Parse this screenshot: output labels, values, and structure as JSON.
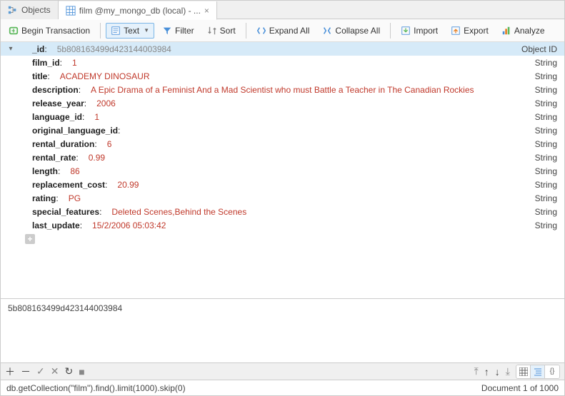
{
  "tabs": [
    {
      "label": "Objects"
    },
    {
      "label": "film @my_mongo_db (local) - ..."
    }
  ],
  "toolbar": {
    "begin_tx": "Begin Transaction",
    "text": "Text",
    "filter": "Filter",
    "sort": "Sort",
    "expand": "Expand All",
    "collapse": "Collapse All",
    "import": "Import",
    "export": "Export",
    "analyze": "Analyze"
  },
  "doc": {
    "_id": {
      "key": "_id",
      "value": "5b808163499d423144003984",
      "type": "Object ID",
      "gray": true
    },
    "film_id": {
      "key": "film_id",
      "value": "1",
      "type": "String"
    },
    "title": {
      "key": "title",
      "value": "ACADEMY DINOSAUR",
      "type": "String"
    },
    "description": {
      "key": "description",
      "value": "A Epic Drama of a Feminist And a Mad Scientist who must Battle a Teacher in The Canadian Rockies",
      "type": "String"
    },
    "release_year": {
      "key": "release_year",
      "value": "2006",
      "type": "String"
    },
    "language_id": {
      "key": "language_id",
      "value": "1",
      "type": "String"
    },
    "original_language_id": {
      "key": "original_language_id",
      "value": "",
      "type": "String"
    },
    "rental_duration": {
      "key": "rental_duration",
      "value": "6",
      "type": "String"
    },
    "rental_rate": {
      "key": "rental_rate",
      "value": "0.99",
      "type": "String"
    },
    "length": {
      "key": "length",
      "value": "86",
      "type": "String"
    },
    "replacement_cost": {
      "key": "replacement_cost",
      "value": "20.99",
      "type": "String"
    },
    "rating": {
      "key": "rating",
      "value": "PG",
      "type": "String"
    },
    "special_features": {
      "key": "special_features",
      "value": "Deleted Scenes,Behind the Scenes",
      "type": "String"
    },
    "last_update": {
      "key": "last_update",
      "value": "15/2/2006 05:03:42",
      "type": "String"
    }
  },
  "detail_id": "5b808163499d423144003984",
  "query_text": "db.getCollection(\"film\").find().limit(1000).skip(0)",
  "doc_position": "Document 1 of 1000"
}
